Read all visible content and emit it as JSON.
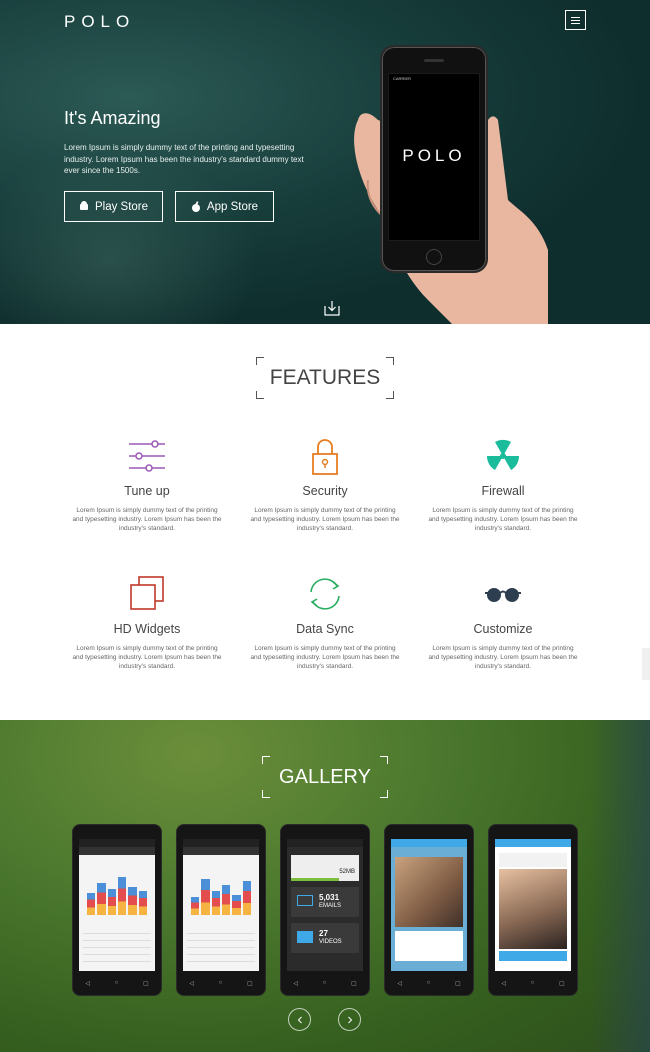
{
  "header": {
    "logo": "POLO",
    "menu_icon": "hamburger-icon"
  },
  "hero": {
    "title": "It's Amazing",
    "text": "Lorem Ipsum is simply dummy text of the printing and typesetting industry. Lorem Ipsum has been the industry's standard dummy text ever since the 1500s.",
    "buttons": [
      {
        "label": "Play Store",
        "icon": "android-icon"
      },
      {
        "label": "App Store",
        "icon": "apple-icon"
      }
    ],
    "phone_brand": "POLO",
    "phone_status": "CARRIER"
  },
  "features": {
    "title": "FEATURES",
    "items": [
      {
        "name": "Tune up",
        "icon": "sliders-icon",
        "color": "#9b59b6",
        "desc": "Lorem Ipsum is simply dummy text of the printing and typesetting industry. Lorem Ipsum has been the industry's standard."
      },
      {
        "name": "Security",
        "icon": "lock-icon",
        "color": "#e67e22",
        "desc": "Lorem Ipsum is simply dummy text of the printing and typesetting industry. Lorem Ipsum has been the industry's standard."
      },
      {
        "name": "Firewall",
        "icon": "radiation-icon",
        "color": "#1abc9c",
        "desc": "Lorem Ipsum is simply dummy text of the printing and typesetting industry. Lorem Ipsum has been the industry's standard."
      },
      {
        "name": "HD Widgets",
        "icon": "widgets-icon",
        "color": "#c0392b",
        "desc": "Lorem Ipsum is simply dummy text of the printing and typesetting industry. Lorem Ipsum has been the industry's standard."
      },
      {
        "name": "Data Sync",
        "icon": "sync-icon",
        "color": "#27ae60",
        "desc": "Lorem Ipsum is simply dummy text of the printing and typesetting industry. Lorem Ipsum has been the industry's standard."
      },
      {
        "name": "Customize",
        "icon": "glasses-icon",
        "color": "#2c3e50",
        "desc": "Lorem Ipsum is simply dummy text of the printing and typesetting industry. Lorem Ipsum has been the industry's standard."
      }
    ]
  },
  "gallery": {
    "title": "GALLERY",
    "nav": {
      "prev_icon": "chevron-left-icon",
      "next_icon": "chevron-right-icon"
    },
    "screens": [
      {
        "widget_label": "5,031",
        "widget_sub": "EMAILS"
      },
      {
        "widget_label": "27",
        "widget_sub": "VIDEOS"
      },
      {
        "size": "52MB"
      }
    ]
  }
}
